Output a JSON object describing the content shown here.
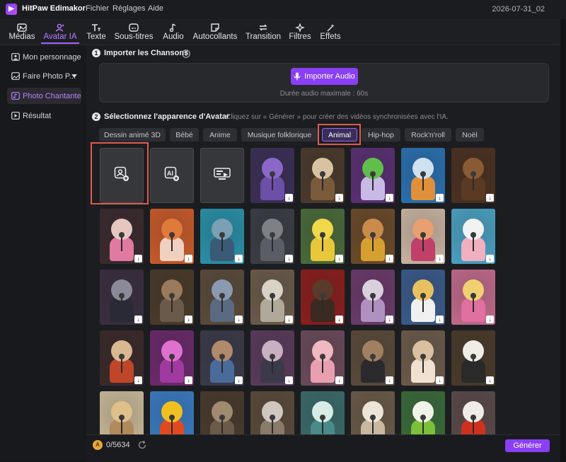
{
  "app": {
    "name": "HitPaw Edimakor",
    "menus": [
      "Fichier",
      "Réglages",
      "Aide"
    ],
    "date": "2026-07-31_02"
  },
  "toolbar": [
    {
      "label": "Médias",
      "icon": "media-icon"
    },
    {
      "label": "Avatar IA",
      "icon": "avatar-ai-icon",
      "active": true
    },
    {
      "label": "Texte",
      "icon": "text-icon"
    },
    {
      "label": "Sous-titres",
      "icon": "subtitles-icon"
    },
    {
      "label": "Audio",
      "icon": "audio-icon"
    },
    {
      "label": "Autocollants",
      "icon": "sticker-icon"
    },
    {
      "label": "Transition",
      "icon": "transition-icon"
    },
    {
      "label": "Filtres",
      "icon": "filter-icon"
    },
    {
      "label": "Effets",
      "icon": "effects-icon"
    }
  ],
  "sidebar": [
    {
      "label": "Mon personnage",
      "icon": "person-icon"
    },
    {
      "label": "Faire Photo P...",
      "icon": "photo-icon",
      "has_dropdown": true
    },
    {
      "label": "Photo Chantante",
      "icon": "singing-photo-icon",
      "active": true
    },
    {
      "label": "Résultat",
      "icon": "result-icon"
    }
  ],
  "step1": {
    "number": "1",
    "title": "Importer les Chansons",
    "button": "Importer Audio",
    "hint": "Durée audio maximale : 60s"
  },
  "step2": {
    "number": "2",
    "title": "Sélectionnez l'apparence d'Avatar",
    "hint": "Cliquez sur « Générer » pour créer des vidéos synchronisées avec l'IA."
  },
  "categories": [
    "Dessin animé 3D",
    "Bébé",
    "Anime",
    "Musique folklorique",
    "Animal",
    "Hip-hop",
    "Rock'n'roll",
    "Noël"
  ],
  "active_category": "Animal",
  "tool_tiles": [
    "upload-photo-icon",
    "ai-generate-avatar-icon",
    "template-avatar-icon"
  ],
  "avatars": [
    {
      "name": "purple-hippo",
      "bg": "#3b2f55",
      "fur": "#8a67c9",
      "outfit": "#6c4fa8"
    },
    {
      "name": "duck-singer",
      "bg": "#4a3a2c",
      "fur": "#d8c2a0",
      "outfit": "#7a5a3b"
    },
    {
      "name": "green-lizard",
      "bg": "#5a2f73",
      "fur": "#5fbf4a",
      "outfit": "#c9b9e6"
    },
    {
      "name": "blue-shark",
      "bg": "#2a6fae",
      "fur": "#cfe0ee",
      "outfit": "#e0903a"
    },
    {
      "name": "highland-cow",
      "bg": "#4a3120",
      "fur": "#8a5a34",
      "outfit": "#5a3a22"
    },
    {
      "name": "pink-leopard",
      "bg": "#3a2a2e",
      "fur": "#e5c7c0",
      "outfit": "#e07aa0"
    },
    {
      "name": "red-fox",
      "bg": "#c65a2a",
      "fur": "#e07a3a",
      "outfit": "#f0d0c0"
    },
    {
      "name": "hippo-blue",
      "bg": "#2a8fa6",
      "fur": "#7b9fb3",
      "outfit": "#3a5a78"
    },
    {
      "name": "gray-monster",
      "bg": "#3a3e44",
      "fur": "#7d8186",
      "outfit": "#5a5e64"
    },
    {
      "name": "yellow-duck",
      "bg": "#4a6a3a",
      "fur": "#f0d84a",
      "outfit": "#e8c83a"
    },
    {
      "name": "guitar-kangaroo",
      "bg": "#6a4a2a",
      "fur": "#c98a4a",
      "outfit": "#d6a030"
    },
    {
      "name": "sunglasses-cat",
      "bg": "#c9b3a0",
      "fur": "#e8a070",
      "outfit": "#c0406a"
    },
    {
      "name": "white-chick",
      "bg": "#4aa0c0",
      "fur": "#f2f2f2",
      "outfit": "#f0b0c0"
    },
    {
      "name": "hat-cat",
      "bg": "#3a2e3e",
      "fur": "#8a8a98",
      "outfit": "#2a2a36"
    },
    {
      "name": "guitar-cat",
      "bg": "#4a3a2a",
      "fur": "#9a7a5a",
      "outfit": "#6a5a4a"
    },
    {
      "name": "gray-elephant",
      "bg": "#5a4a3a",
      "fur": "#8a9ab0",
      "outfit": "#5a6a80"
    },
    {
      "name": "fluffy-sheep",
      "bg": "#6a5a4a",
      "fur": "#d8d2c8",
      "outfit": "#b0a898"
    },
    {
      "name": "red-cow",
      "bg": "#8a1e1e",
      "fur": "#5a3a2a",
      "outfit": "#3a2a22"
    },
    {
      "name": "top-hat-cat",
      "bg": "#6a3a6a",
      "fur": "#d8d0dc",
      "outfit": "#b090c0"
    },
    {
      "name": "leopard-cat",
      "bg": "#3a5a8a",
      "fur": "#e8c060",
      "outfit": "#f0f0f0"
    },
    {
      "name": "pikachu-guitar",
      "bg": "#c06a8a",
      "fur": "#f0d070",
      "outfit": "#e070a0"
    },
    {
      "name": "giraffe-singer",
      "bg": "#3a2a2a",
      "fur": "#d8b890",
      "outfit": "#c0462a"
    },
    {
      "name": "pink-bunny",
      "bg": "#6a2a6a",
      "fur": "#e070d0",
      "outfit": "#a03aa0"
    },
    {
      "name": "kangaroo-denim",
      "bg": "#3a3a4a",
      "fur": "#b08a6a",
      "outfit": "#4a6a9a"
    },
    {
      "name": "rabbit-hat",
      "bg": "#5a3a5a",
      "fur": "#c8b0c0",
      "outfit": "#3a3a4a"
    },
    {
      "name": "pink-pig",
      "bg": "#6a4a5a",
      "fur": "#f0b8c0",
      "outfit": "#e8a0b0"
    },
    {
      "name": "hyena-suit",
      "bg": "#5a4a3a",
      "fur": "#a08060",
      "outfit": "#2a2a2e"
    },
    {
      "name": "mouse-knit",
      "bg": "#6a5a4a",
      "fur": "#d8c0a0",
      "outfit": "#f0e0d0"
    },
    {
      "name": "dairy-cow",
      "bg": "#4a3a2a",
      "fur": "#f0ece6",
      "outfit": "#2a2a2a"
    },
    {
      "name": "giraffe-2",
      "bg": "#c8b898",
      "fur": "#e0c08a",
      "outfit": "#b08a5a"
    },
    {
      "name": "chicken-mascot",
      "bg": "#3a7ac0",
      "fur": "#f0c020",
      "outfit": "#e04a20"
    },
    {
      "name": "meerkat",
      "bg": "#4a3a2e",
      "fur": "#a08a70",
      "outfit": "#6a5a48"
    },
    {
      "name": "hedgehog",
      "bg": "#5a4a3a",
      "fur": "#d0c8c0",
      "outfit": "#8a7a6a"
    },
    {
      "name": "seal-pup",
      "bg": "#3a6a6a",
      "fur": "#d8ece6",
      "outfit": "#4a8a8a"
    },
    {
      "name": "lamb",
      "bg": "#6a5a48",
      "fur": "#ece4d8",
      "outfit": "#c8b8a0"
    },
    {
      "name": "white-bird",
      "bg": "#3a6a3a",
      "fur": "#f0f4e8",
      "outfit": "#7ac03a"
    },
    {
      "name": "red-hat-cat",
      "bg": "#5a4a4a",
      "fur": "#f0ece8",
      "outfit": "#d0301e"
    }
  ],
  "bottom": {
    "credits": "0/5634",
    "generate": "Générer"
  }
}
